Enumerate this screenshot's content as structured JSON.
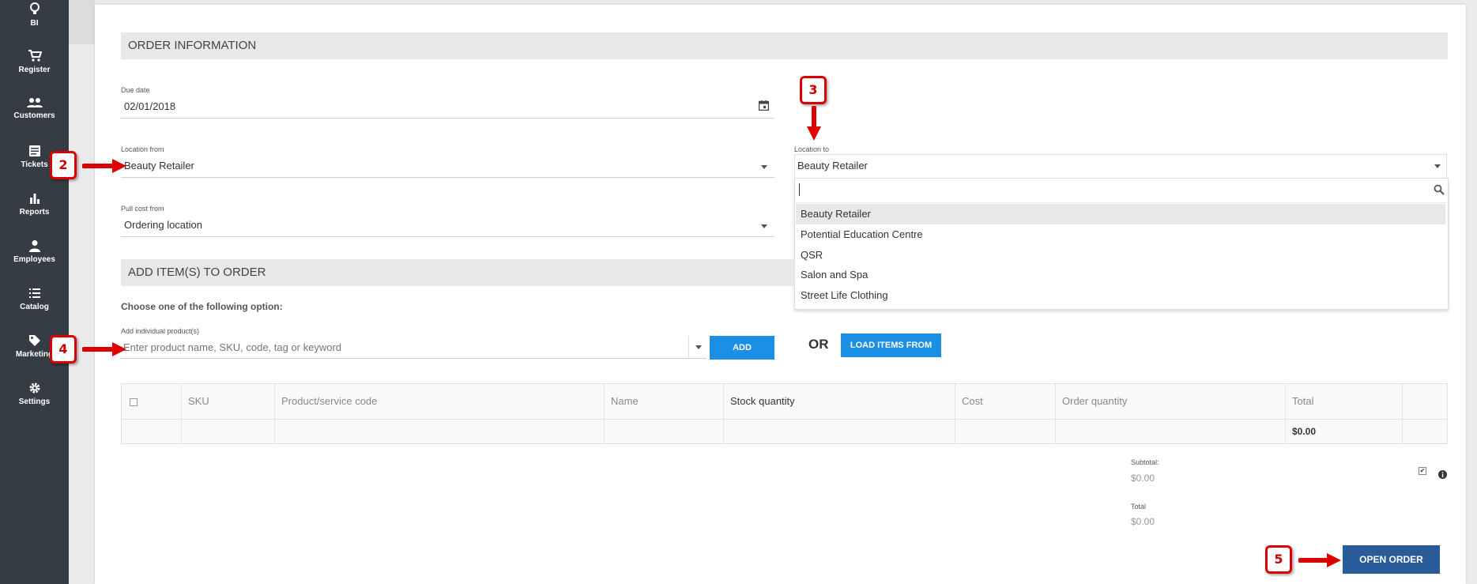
{
  "sidebar": {
    "items": [
      {
        "label": "BI",
        "icon": "bulb-icon"
      },
      {
        "label": "Register",
        "icon": "cart-icon"
      },
      {
        "label": "Customers",
        "icon": "people-icon"
      },
      {
        "label": "Tickets",
        "icon": "ticket-icon"
      },
      {
        "label": "Reports",
        "icon": "bar-chart-icon"
      },
      {
        "label": "Employees",
        "icon": "person-icon"
      },
      {
        "label": "Catalog",
        "icon": "list-icon"
      },
      {
        "label": "Marketing",
        "icon": "tag-icon"
      },
      {
        "label": "Settings",
        "icon": "gear-icon"
      }
    ]
  },
  "order_info": {
    "title": "ORDER INFORMATION",
    "due_date": {
      "label": "Due date",
      "value": "02/01/2018"
    },
    "location_from": {
      "label": "Location from",
      "value": "Beauty Retailer"
    },
    "location_to": {
      "label": "Location to",
      "value": "Beauty Retailer"
    },
    "pull_cost_from": {
      "label": "Pull cost from",
      "value": "Ordering location"
    }
  },
  "location_dropdown": {
    "search_value": "",
    "options": [
      "Beauty Retailer",
      "Potential Education Centre",
      "QSR",
      "Salon and Spa",
      "Street Life Clothing"
    ],
    "highlighted": "Beauty Retailer"
  },
  "add_items": {
    "title": "ADD ITEM(S) TO ORDER",
    "instruction": "Choose one of the following option:",
    "field_label": "Add individual product(s)",
    "placeholder": "Enter product name, SKU, code, tag or keyword",
    "add_button": "ADD",
    "or_text": "OR",
    "load_button": "LOAD ITEMS FROM"
  },
  "table": {
    "headers": [
      "SKU",
      "Product/service code",
      "Name",
      "Stock quantity",
      "Cost",
      "Order quantity",
      "Total"
    ],
    "footer_total": "$0.00"
  },
  "summary": {
    "subtotal_label": "Subtotal:",
    "subtotal_value": "$0.00",
    "total_label": "Total",
    "total_value": "$0.00"
  },
  "open_order_button": "OPEN ORDER",
  "callouts": [
    "2",
    "3",
    "4",
    "5"
  ],
  "colors": {
    "sidebar": "#353c44",
    "accent_blue": "#1a8fe3",
    "open_order_blue": "#2a5c9a",
    "callout_red": "#dd0000"
  }
}
